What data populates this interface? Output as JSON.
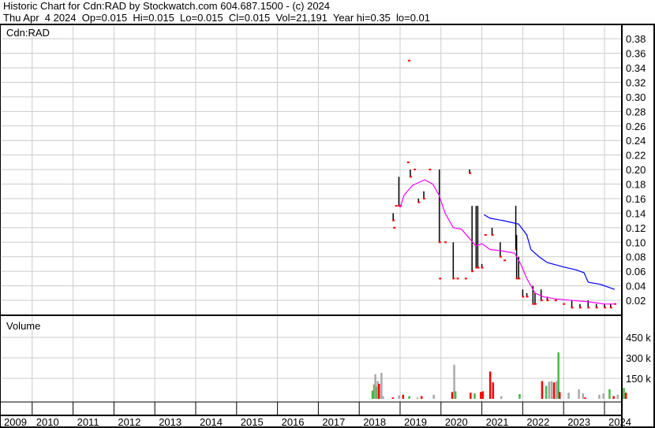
{
  "header": {
    "title": "Historic Chart for Cdn:RAD by Stockwatch.com 604.687.1500 - (c) 2024",
    "quote": "Thu Apr  4 2024  Op=0.015  Hi=0.015  Lo=0.015  Cl=0.015  Vol=21,191  Year hi=0.35  lo=0.01"
  },
  "chart_data": [
    {
      "type": "bar",
      "title": "Cdn:RAD",
      "ylim": [
        0,
        0.39
      ],
      "yticks": [
        "0.02",
        "0.04",
        "0.06",
        "0.08",
        "0.10",
        "0.12",
        "0.14",
        "0.16",
        "0.18",
        "0.20",
        "0.22",
        "0.24",
        "0.26",
        "0.28",
        "0.30",
        "0.32",
        "0.34",
        "0.36",
        "0.38"
      ],
      "ytick_values": [
        0.02,
        0.04,
        0.06,
        0.08,
        0.1,
        0.12,
        0.14,
        0.16,
        0.18,
        0.2,
        0.22,
        0.24,
        0.26,
        0.28,
        0.3,
        0.32,
        0.34,
        0.36,
        0.38
      ],
      "bars": [
        [
          2018.83,
          0.14,
          0.13
        ],
        [
          2018.85,
          0.12,
          0.12
        ],
        [
          2018.97,
          0.19,
          0.15
        ],
        [
          2018.9,
          0.15,
          0.15
        ],
        [
          2019.0,
          0.15,
          0.15
        ],
        [
          2019.19,
          0.21,
          0.21
        ],
        [
          2019.21,
          0.35,
          0.35
        ],
        [
          2019.25,
          0.2,
          0.19
        ],
        [
          2019.35,
          0.2,
          0.2
        ],
        [
          2019.45,
          0.16,
          0.155
        ],
        [
          2019.58,
          0.17,
          0.16
        ],
        [
          2019.72,
          0.2,
          0.2
        ],
        [
          2019.96,
          0.2,
          0.1
        ],
        [
          2019.97,
          0.05,
          0.05
        ],
        [
          2020.1,
          0.1,
          0.1
        ],
        [
          2020.3,
          0.1,
          0.05
        ],
        [
          2020.4,
          0.05,
          0.05
        ],
        [
          2020.6,
          0.05,
          0.05
        ],
        [
          2020.7,
          0.2,
          0.195
        ],
        [
          2020.76,
          0.15,
          0.06
        ],
        [
          2020.86,
          0.15,
          0.065
        ],
        [
          2020.9,
          0.15,
          0.065
        ],
        [
          2021.0,
          0.07,
          0.065
        ],
        [
          2021.08,
          0.11,
          0.11
        ],
        [
          2021.25,
          0.12,
          0.11
        ],
        [
          2021.45,
          0.1,
          0.08
        ],
        [
          2021.55,
          0.075,
          0.075
        ],
        [
          2021.83,
          0.15,
          0.09
        ],
        [
          2021.85,
          0.11,
          0.05
        ],
        [
          2021.9,
          0.08,
          0.05
        ],
        [
          2022.0,
          0.035,
          0.025
        ],
        [
          2022.1,
          0.03,
          0.025
        ],
        [
          2022.25,
          0.04,
          0.015
        ],
        [
          2022.3,
          0.03,
          0.015
        ],
        [
          2022.45,
          0.035,
          0.02
        ],
        [
          2022.6,
          0.025,
          0.02
        ],
        [
          2022.8,
          0.02,
          0.02
        ],
        [
          2023.0,
          0.015,
          0.015
        ],
        [
          2023.2,
          0.02,
          0.01
        ],
        [
          2023.4,
          0.015,
          0.01
        ],
        [
          2023.6,
          0.02,
          0.01
        ],
        [
          2023.8,
          0.015,
          0.01
        ],
        [
          2024.0,
          0.015,
          0.01
        ],
        [
          2024.15,
          0.015,
          0.01
        ],
        [
          2024.25,
          0.015,
          0.015
        ]
      ],
      "series": [
        {
          "name": "MA short",
          "color": "#ff00ff",
          "points": [
            [
              2019.0,
              0.148
            ],
            [
              2019.1,
              0.165
            ],
            [
              2019.3,
              0.178
            ],
            [
              2019.6,
              0.186
            ],
            [
              2019.8,
              0.18
            ],
            [
              2019.95,
              0.165
            ],
            [
              2020.1,
              0.14
            ],
            [
              2020.3,
              0.12
            ],
            [
              2020.5,
              0.118
            ],
            [
              2020.7,
              0.105
            ],
            [
              2020.85,
              0.095
            ],
            [
              2021.0,
              0.098
            ],
            [
              2021.2,
              0.09
            ],
            [
              2021.5,
              0.088
            ],
            [
              2021.8,
              0.085
            ],
            [
              2021.95,
              0.07
            ],
            [
              2022.1,
              0.05
            ],
            [
              2022.3,
              0.03
            ],
            [
              2022.5,
              0.025
            ],
            [
              2022.8,
              0.022
            ],
            [
              2023.2,
              0.02
            ],
            [
              2023.6,
              0.018
            ],
            [
              2024.0,
              0.015
            ],
            [
              2024.25,
              0.015
            ]
          ]
        },
        {
          "name": "MA long",
          "color": "#0000ff",
          "points": [
            [
              2021.05,
              0.138
            ],
            [
              2021.2,
              0.133
            ],
            [
              2021.5,
              0.13
            ],
            [
              2021.9,
              0.125
            ],
            [
              2022.1,
              0.11
            ],
            [
              2022.2,
              0.09
            ],
            [
              2022.4,
              0.08
            ],
            [
              2022.6,
              0.072
            ],
            [
              2023.0,
              0.066
            ],
            [
              2023.3,
              0.062
            ],
            [
              2023.5,
              0.058
            ],
            [
              2023.6,
              0.045
            ],
            [
              2023.9,
              0.042
            ],
            [
              2024.1,
              0.038
            ],
            [
              2024.25,
              0.035
            ]
          ]
        }
      ]
    },
    {
      "type": "bar",
      "title": "Volume",
      "yticks": [
        "150 k",
        "300 k",
        "450 k"
      ],
      "ytick_values": [
        150000,
        300000,
        450000
      ],
      "bars": [
        [
          2018.8,
          60000,
          "#44bb44"
        ],
        [
          2018.84,
          105000,
          "#44bb44"
        ],
        [
          2018.87,
          180000,
          "#aaaaaa"
        ],
        [
          2018.9,
          90000,
          "#44bb44"
        ],
        [
          2018.93,
          130000,
          "#aaaaaa"
        ],
        [
          2018.96,
          110000,
          "#ff0000"
        ],
        [
          2019.02,
          190000,
          "#aaaaaa"
        ],
        [
          2019.06,
          20000,
          "#aaaaaa"
        ],
        [
          2019.3,
          10000,
          "#ff0000"
        ],
        [
          2019.45,
          25000,
          "#aaaaaa"
        ],
        [
          2019.55,
          30000,
          "#ff0000"
        ],
        [
          2019.7,
          20000,
          "#44bb44"
        ],
        [
          2019.9,
          10000,
          "#aaaaaa"
        ],
        [
          2020.0,
          20000,
          "#ff0000"
        ],
        [
          2020.3,
          30000,
          "#aaaaaa"
        ],
        [
          2020.75,
          50000,
          "#ff0000"
        ],
        [
          2020.8,
          250000,
          "#aaaaaa"
        ],
        [
          2020.83,
          55000,
          "#44bb44"
        ],
        [
          2021.2,
          45000,
          "#ff0000"
        ],
        [
          2021.3,
          40000,
          "#44bb44"
        ],
        [
          2021.45,
          50000,
          "#ff0000"
        ],
        [
          2021.5,
          55000,
          "#ff0000"
        ],
        [
          2021.68,
          200000,
          "#ff0000"
        ],
        [
          2021.75,
          120000,
          "#ff0000"
        ],
        [
          2021.95,
          20000,
          "#aaaaaa"
        ],
        [
          2022.4,
          35000,
          "#44bb44"
        ],
        [
          2022.95,
          130000,
          "#ff0000"
        ],
        [
          2023.05,
          95000,
          "#44bb44"
        ],
        [
          2023.12,
          125000,
          "#aaaaaa"
        ],
        [
          2023.18,
          130000,
          "#aaaaaa"
        ],
        [
          2023.24,
          120000,
          "#ff0000"
        ],
        [
          2023.3,
          130000,
          "#aaaaaa"
        ],
        [
          2023.35,
          340000,
          "#44bb44"
        ],
        [
          2023.38,
          50000,
          "#ff0000"
        ],
        [
          2023.6,
          45000,
          "#aaaaaa"
        ],
        [
          2023.85,
          70000,
          "#aaaaaa"
        ],
        [
          2023.95,
          40000,
          "#aaaaaa"
        ],
        [
          2024.0,
          10000,
          "#ff0000"
        ],
        [
          2024.35,
          30000,
          "#aaaaaa"
        ],
        [
          2024.45,
          40000,
          "#aaaaaa"
        ],
        [
          2024.6,
          70000,
          "#44bb44"
        ],
        [
          2024.7,
          20000,
          "#ff0000"
        ],
        [
          2024.8,
          30000,
          "#aaaaaa"
        ],
        [
          2024.95,
          80000,
          "#44bb44"
        ],
        [
          2025.0,
          45000,
          "#ff0000"
        ]
      ]
    }
  ],
  "xaxis": {
    "years": [
      "2009",
      "2010",
      "2011",
      "2012",
      "2013",
      "2014",
      "2015",
      "2016",
      "2017",
      "2018",
      "2019",
      "2020",
      "2021",
      "2022",
      "2023",
      "2024"
    ]
  }
}
